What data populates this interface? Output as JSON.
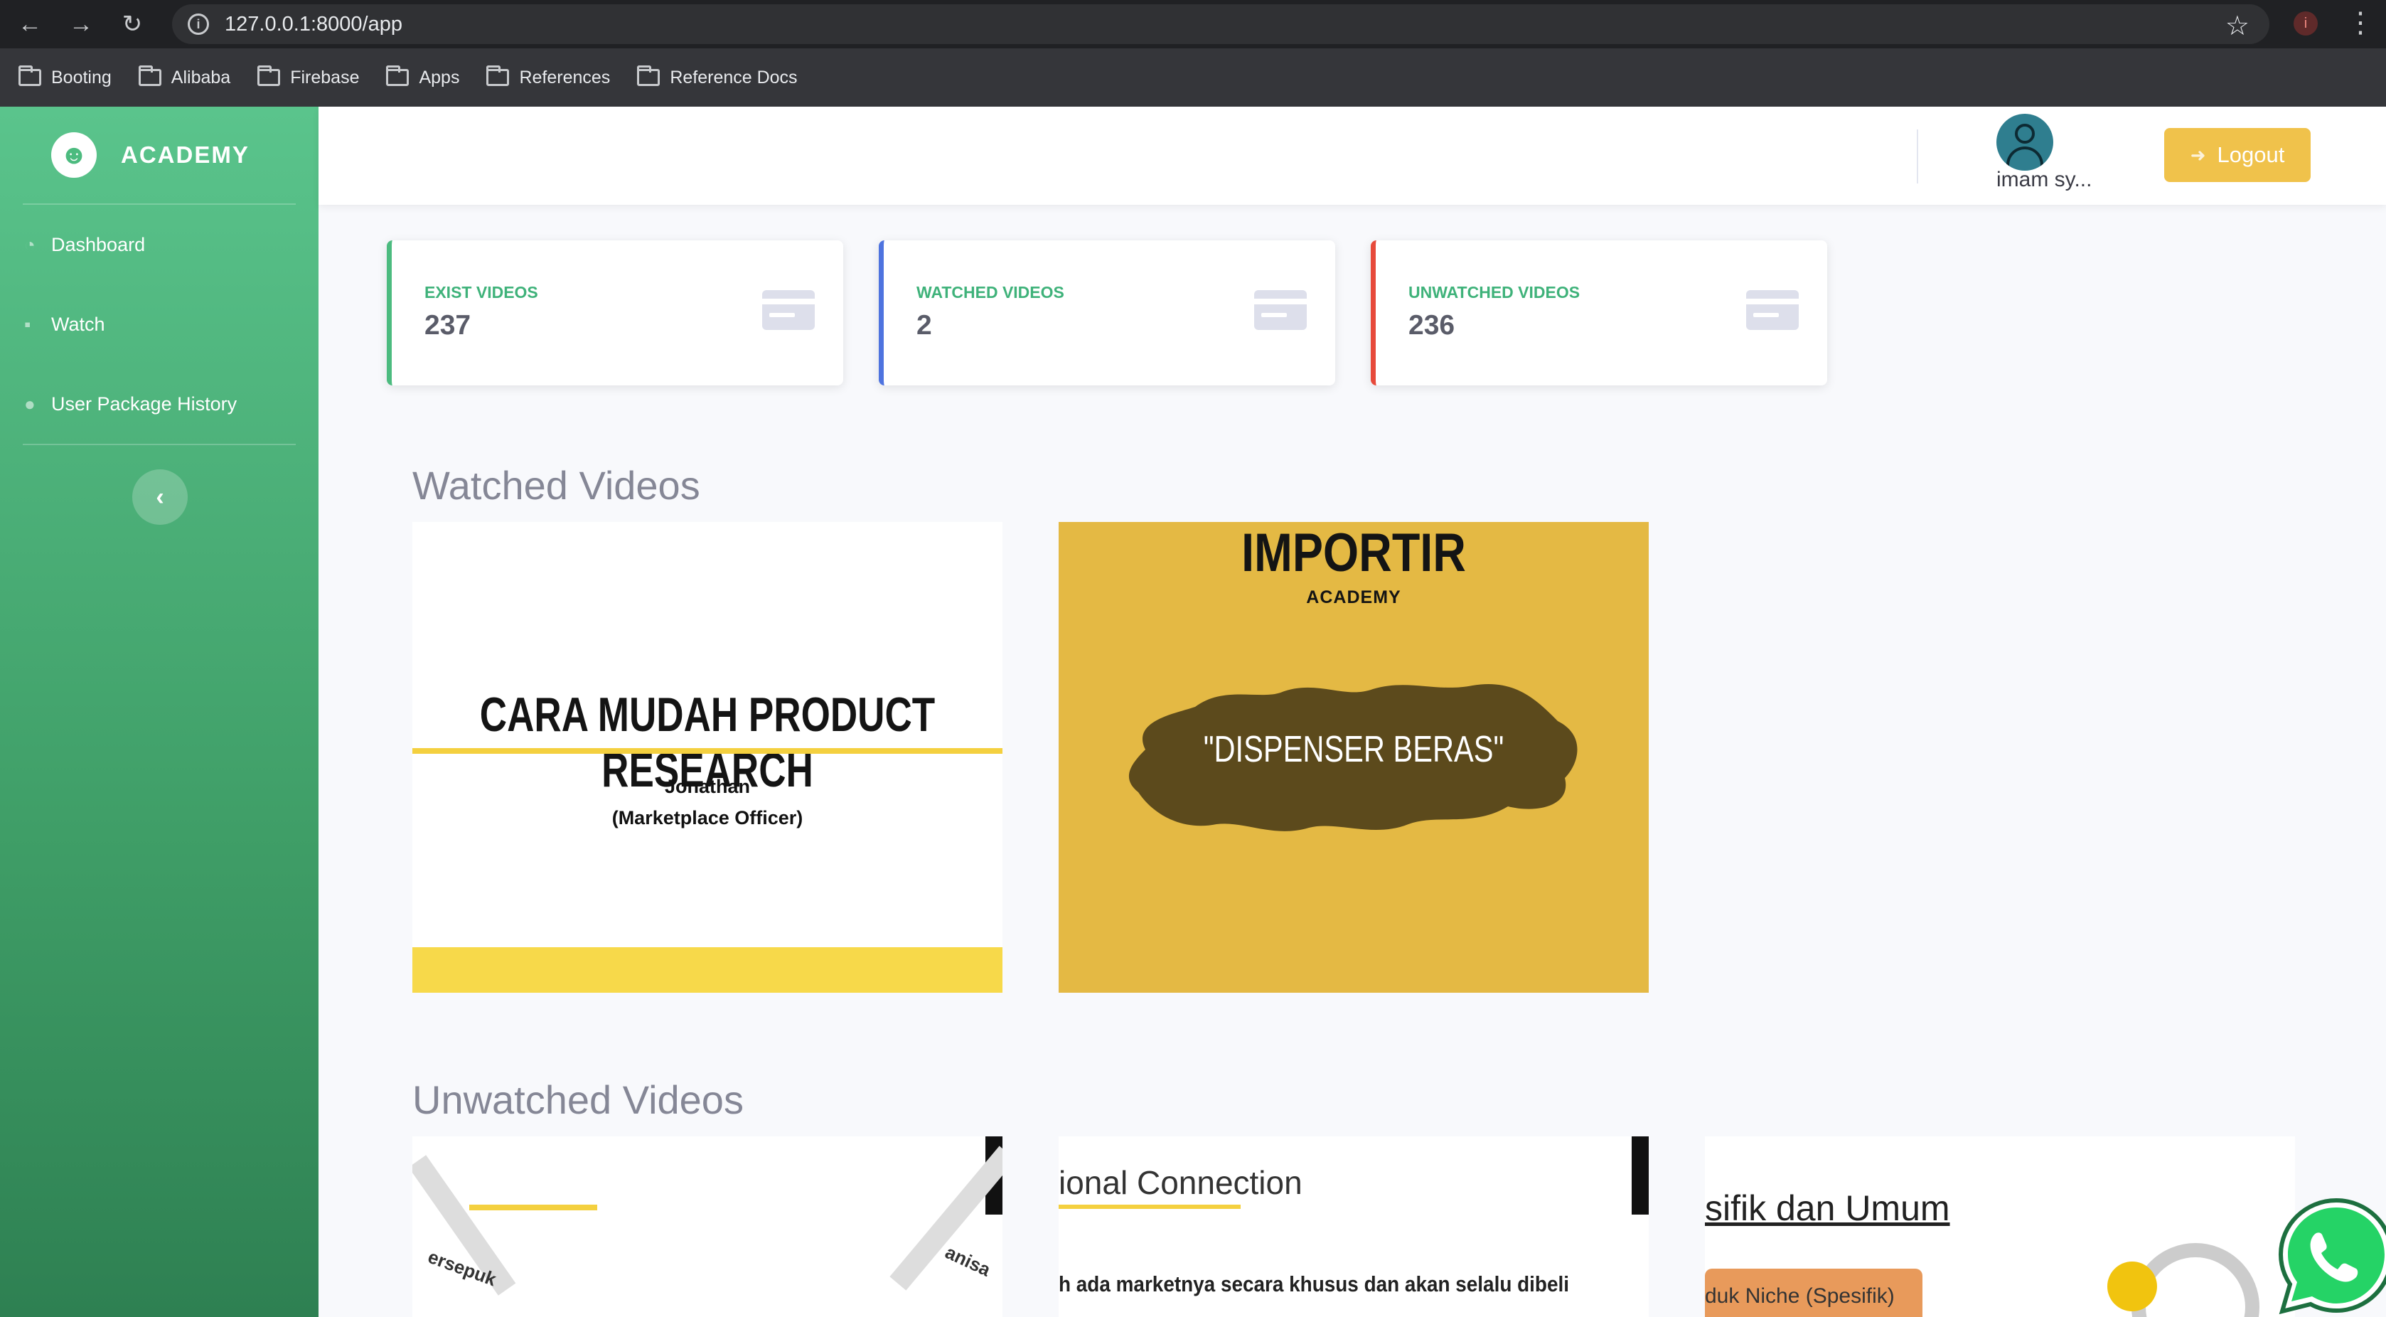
{
  "browser": {
    "url": "127.0.0.1:8000/app",
    "profile_initial": "i",
    "bookmarks": [
      "Booting",
      "Alibaba",
      "Firebase",
      "Apps",
      "References",
      "Reference Docs"
    ]
  },
  "sidebar": {
    "brand": "ACADEMY",
    "items": [
      {
        "label": "Dashboard",
        "icon": "dashboard-icon"
      },
      {
        "label": "Watch",
        "icon": "video-camera-icon"
      },
      {
        "label": "User Package History",
        "icon": "user-icon"
      }
    ]
  },
  "topbar": {
    "username": "imam sy...",
    "logout_label": "Logout"
  },
  "stats": [
    {
      "label": "EXIST VIDEOS",
      "value": "237",
      "color": "#4cbb7f"
    },
    {
      "label": "WATCHED VIDEOS",
      "value": "2",
      "color": "#4e73df"
    },
    {
      "label": "UNWATCHED VIDEOS",
      "value": "236",
      "color": "#e74a3b"
    }
  ],
  "sections": {
    "watched_title": "Watched Videos",
    "unwatched_title": "Unwatched Videos"
  },
  "watched": [
    {
      "title": "CARA MUDAH PRODUCT RESEARCH",
      "presenter": "Jonathan",
      "role": "(Marketplace Officer)"
    },
    {
      "brand": "IMPORTIR",
      "brand_sub": "ACADEMY",
      "product": "\"DISPENSER BERAS\""
    }
  ],
  "unwatched": [
    {
      "text_left": "ersepuk",
      "text_right": "anisa"
    },
    {
      "heading": "ional Connection",
      "sub": "h ada marketnya secara khusus dan akan selalu dibeli"
    },
    {
      "heading": "sifik dan Umum",
      "badge": "duk Niche (Spesifik)"
    }
  ],
  "colors": {
    "sidebar": "#4cbb7f",
    "logout": "#f0c24b",
    "whatsapp": "#25d366"
  }
}
